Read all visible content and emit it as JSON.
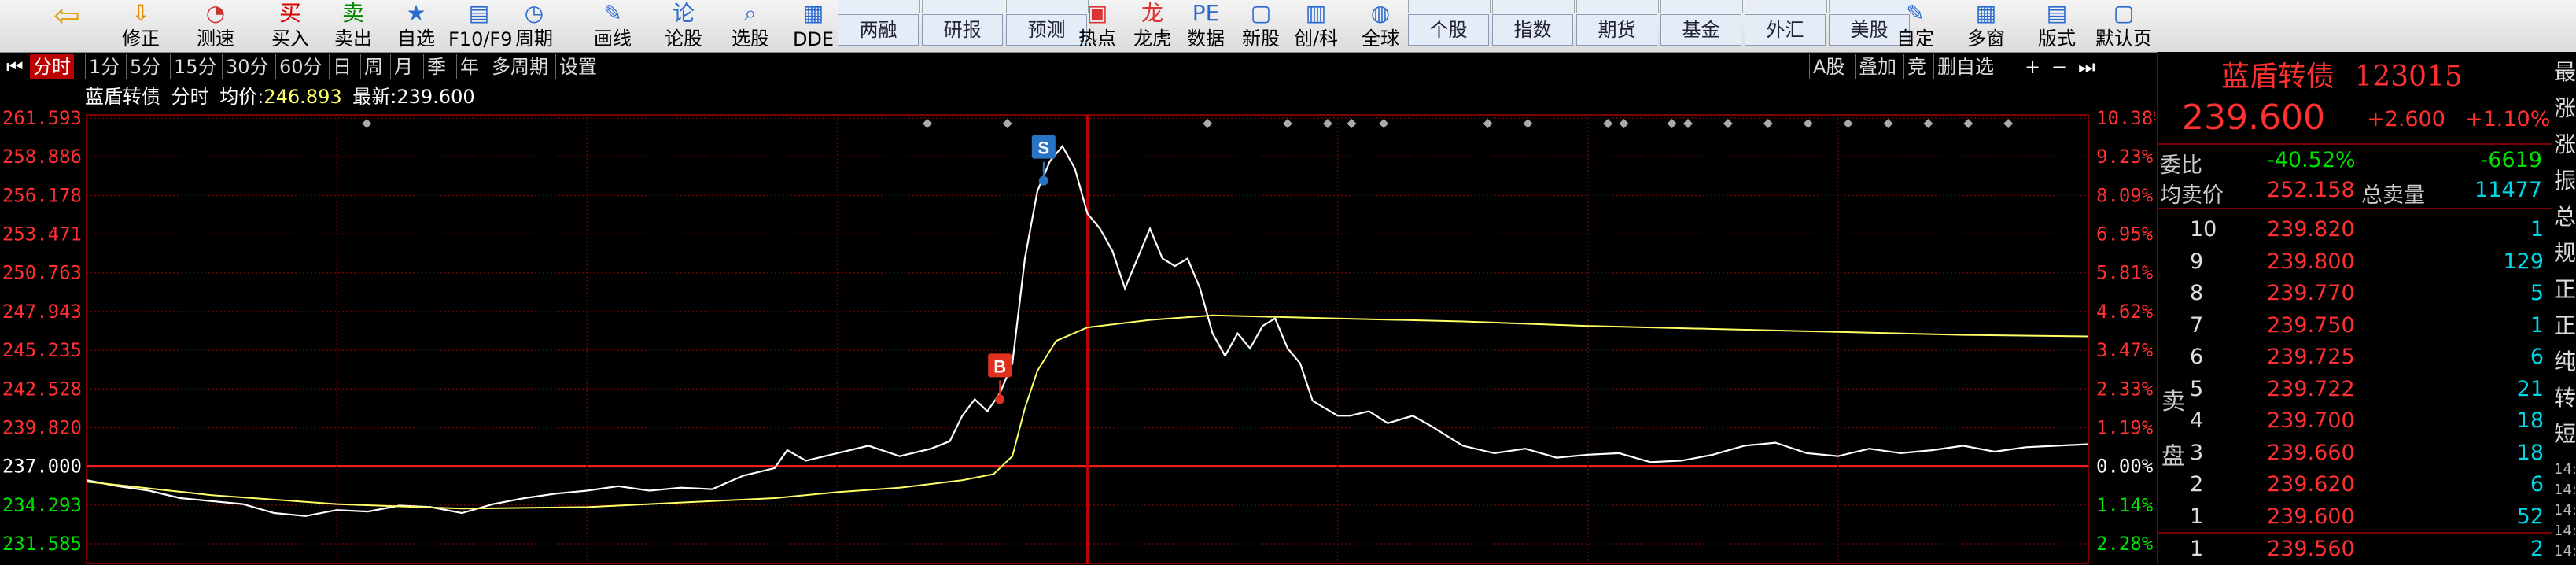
{
  "toolbar": {
    "buttons": [
      {
        "label": "修正",
        "icon": "arrow-down-icon"
      },
      {
        "label": "测速",
        "icon": "speedometer-icon"
      },
      {
        "label": "买入",
        "icon": "buy-icon"
      },
      {
        "label": "卖出",
        "icon": "sell-icon"
      },
      {
        "label": "自选",
        "icon": "star-icon"
      },
      {
        "label": "F10/F9",
        "icon": "f10-icon"
      },
      {
        "label": "周期",
        "icon": "clock-icon"
      },
      {
        "label": "画线",
        "icon": "pen-icon"
      },
      {
        "label": "论股",
        "icon": "chat-icon"
      },
      {
        "label": "选股",
        "icon": "magnifier-icon"
      },
      {
        "label": "DDE",
        "icon": "dde-icon"
      }
    ],
    "tabs1": [
      "两融",
      "研报",
      "预测"
    ],
    "buttons2": [
      {
        "label": "热点",
        "icon": "hot-icon"
      },
      {
        "label": "龙虎",
        "icon": "tiger-icon"
      },
      {
        "label": "数据",
        "icon": "pe-icon"
      },
      {
        "label": "新股",
        "icon": "new-stock-icon"
      },
      {
        "label": "创/科",
        "icon": "chart-icon"
      },
      {
        "label": "全球",
        "icon": "globe-icon"
      }
    ],
    "tabs2": [
      "个股",
      "指数",
      "期货",
      "基金",
      "外汇",
      "美股"
    ],
    "buttons3": [
      {
        "label": "自定",
        "icon": "custom-icon"
      },
      {
        "label": "多窗",
        "icon": "multiwindow-icon"
      },
      {
        "label": "版式",
        "icon": "layout-icon"
      },
      {
        "label": "默认页",
        "icon": "default-page-icon"
      }
    ]
  },
  "periods": {
    "items": [
      "分时",
      "1分",
      "5分",
      "15分",
      "30分",
      "60分",
      "日",
      "周",
      "月",
      "季",
      "年",
      "多周期",
      "设置"
    ],
    "active": "分时",
    "right_items": [
      "A股",
      "叠加",
      "竞",
      "删自选"
    ]
  },
  "info": {
    "name": "蓝盾转债",
    "mode": "分时",
    "avg_label": "均价:",
    "avg_value": "246.893",
    "last_label": "最新:",
    "last_value": "239.600"
  },
  "chart_data": {
    "type": "line",
    "y_labels_left": [
      "261.593",
      "258.886",
      "256.178",
      "253.471",
      "250.763",
      "247.943",
      "245.235",
      "242.528",
      "239.820",
      "237.000",
      "234.293",
      "231.585"
    ],
    "y_labels_right": [
      "10.38%",
      "9.23%",
      "8.09%",
      "6.95%",
      "5.81%",
      "4.62%",
      "3.47%",
      "2.33%",
      "1.19%",
      "0.00%",
      "1.14%",
      "2.28%"
    ],
    "prev_close": 237.0,
    "ylim": [
      231.585,
      261.593
    ],
    "x_minutes": 240,
    "series": [
      {
        "name": "最新",
        "color": "#ffffff",
        "points": [
          [
            0,
            237.2
          ],
          [
            5,
            236.8
          ],
          [
            10,
            236.5
          ],
          [
            15,
            236.0
          ],
          [
            20,
            235.8
          ],
          [
            25,
            235.6
          ],
          [
            30,
            235.0
          ],
          [
            35,
            234.8
          ],
          [
            40,
            235.2
          ],
          [
            45,
            235.1
          ],
          [
            50,
            235.5
          ],
          [
            55,
            235.4
          ],
          [
            60,
            235.0
          ],
          [
            65,
            235.6
          ],
          [
            70,
            236.0
          ],
          [
            75,
            236.3
          ],
          [
            80,
            236.5
          ],
          [
            85,
            236.8
          ],
          [
            90,
            236.5
          ],
          [
            95,
            236.7
          ],
          [
            100,
            236.6
          ],
          [
            105,
            237.5
          ],
          [
            110,
            238.0
          ],
          [
            112,
            239.2
          ],
          [
            115,
            238.5
          ],
          [
            120,
            239.0
          ],
          [
            125,
            239.5
          ],
          [
            130,
            238.8
          ],
          [
            135,
            239.3
          ],
          [
            138,
            239.8
          ],
          [
            140,
            241.5
          ],
          [
            142,
            242.6
          ],
          [
            144,
            241.8
          ],
          [
            146,
            243.0
          ],
          [
            148,
            245.0
          ],
          [
            150,
            252.0
          ],
          [
            152,
            256.5
          ],
          [
            154,
            258.5
          ],
          [
            156,
            259.5
          ],
          [
            158,
            258.0
          ],
          [
            160,
            255.0
          ],
          [
            162,
            254.0
          ],
          [
            164,
            252.5
          ],
          [
            166,
            250.0
          ],
          [
            168,
            252.0
          ],
          [
            170,
            254.0
          ],
          [
            172,
            252.0
          ],
          [
            174,
            251.5
          ],
          [
            176,
            252.0
          ],
          [
            178,
            250.0
          ],
          [
            180,
            247.0
          ],
          [
            182,
            245.5
          ],
          [
            184,
            247.0
          ],
          [
            186,
            246.0
          ],
          [
            188,
            247.5
          ],
          [
            190,
            248.0
          ],
          [
            192,
            246.0
          ],
          [
            194,
            245.0
          ],
          [
            196,
            242.5
          ],
          [
            198,
            242.0
          ],
          [
            200,
            241.5
          ],
          [
            202,
            241.5
          ],
          [
            205,
            241.8
          ],
          [
            208,
            241.0
          ],
          [
            212,
            241.5
          ],
          [
            215,
            240.8
          ],
          [
            220,
            239.5
          ],
          [
            225,
            239.0
          ],
          [
            230,
            239.3
          ],
          [
            235,
            238.7
          ],
          [
            240,
            238.9
          ],
          [
            245,
            239.0
          ],
          [
            250,
            238.4
          ],
          [
            255,
            238.5
          ],
          [
            260,
            238.9
          ],
          [
            265,
            239.5
          ],
          [
            270,
            239.7
          ],
          [
            275,
            239.0
          ],
          [
            280,
            238.8
          ],
          [
            285,
            239.3
          ],
          [
            290,
            239.0
          ],
          [
            295,
            239.2
          ],
          [
            300,
            239.5
          ],
          [
            305,
            239.1
          ],
          [
            310,
            239.4
          ],
          [
            315,
            239.5
          ],
          [
            320,
            239.6
          ]
        ],
        "note_x_max": 320
      },
      {
        "name": "均价",
        "color": "#ffff66",
        "points": [
          [
            0,
            237.1
          ],
          [
            20,
            236.2
          ],
          [
            40,
            235.6
          ],
          [
            60,
            235.3
          ],
          [
            80,
            235.4
          ],
          [
            100,
            235.8
          ],
          [
            110,
            236.0
          ],
          [
            120,
            236.4
          ],
          [
            130,
            236.7
          ],
          [
            140,
            237.2
          ],
          [
            145,
            237.6
          ],
          [
            148,
            238.8
          ],
          [
            150,
            242.0
          ],
          [
            152,
            244.5
          ],
          [
            155,
            246.5
          ],
          [
            160,
            247.4
          ],
          [
            170,
            247.9
          ],
          [
            180,
            248.2
          ],
          [
            200,
            248.0
          ],
          [
            220,
            247.8
          ],
          [
            240,
            247.5
          ],
          [
            260,
            247.3
          ],
          [
            280,
            247.1
          ],
          [
            300,
            246.9
          ],
          [
            320,
            246.8
          ]
        ]
      }
    ],
    "markers": [
      {
        "label": "B",
        "color": "#e03020",
        "x": 146,
        "y": 242.6
      },
      {
        "label": "S",
        "color": "#2a74c8",
        "x": 153,
        "y": 257.2
      }
    ]
  },
  "quote": {
    "name": "蓝盾转债",
    "code": "123015",
    "price": "239.600",
    "change": "+2.600",
    "change_pct": "+1.10%",
    "ratio_label": "委比",
    "ratio_value": "-40.52%",
    "ratio_diff": "-6619",
    "avg_sell_label": "均卖价",
    "avg_sell_value": "252.158",
    "total_sell_label": "总卖量",
    "total_sell_value": "11477",
    "sell_label": "卖盘",
    "sells": [
      {
        "level": "10",
        "price": "239.820",
        "vol": "1"
      },
      {
        "level": "9",
        "price": "239.800",
        "vol": "129"
      },
      {
        "level": "8",
        "price": "239.770",
        "vol": "5"
      },
      {
        "level": "7",
        "price": "239.750",
        "vol": "1"
      },
      {
        "level": "6",
        "price": "239.725",
        "vol": "6"
      },
      {
        "level": "5",
        "price": "239.722",
        "vol": "21"
      },
      {
        "level": "4",
        "price": "239.700",
        "vol": "18"
      },
      {
        "level": "3",
        "price": "239.660",
        "vol": "18"
      },
      {
        "level": "2",
        "price": "239.620",
        "vol": "6"
      },
      {
        "level": "1",
        "price": "239.600",
        "vol": "52"
      }
    ],
    "buys": [
      {
        "level": "1",
        "price": "239.560",
        "vol": "2"
      }
    ]
  },
  "farstrip": {
    "chars": [
      "最",
      "涨",
      "涨",
      "振",
      "总",
      "规",
      "正",
      "正",
      "纯",
      "转",
      "短"
    ],
    "small": [
      "14:",
      "14:",
      "14:",
      "14:",
      "14:"
    ]
  }
}
